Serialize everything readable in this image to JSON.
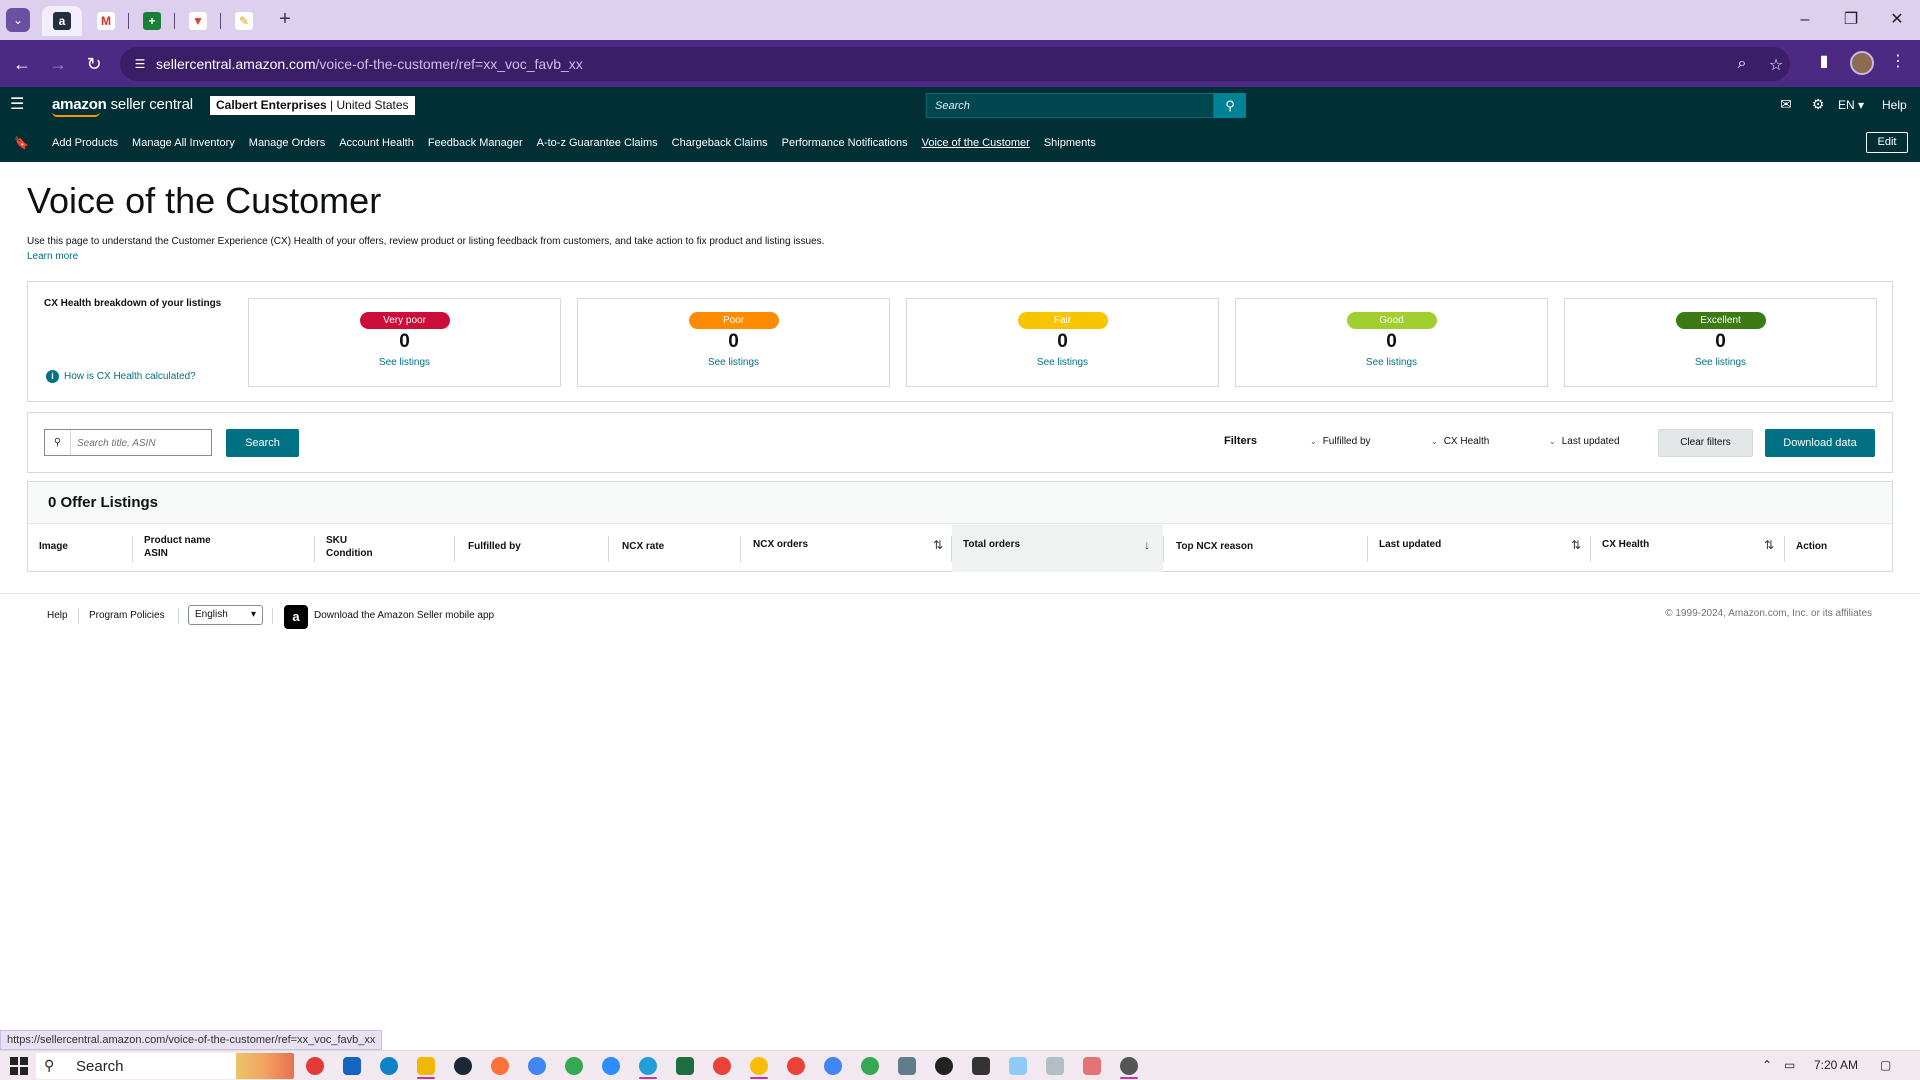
{
  "browser": {
    "tabs": [
      {
        "icon": "amazon-favicon",
        "active": true
      },
      {
        "icon": "gmail-favicon"
      },
      {
        "icon": "sheets-favicon"
      },
      {
        "icon": "todoist-favicon"
      },
      {
        "icon": "pen-favicon"
      }
    ],
    "url_host": "sellercentral.amazon.com",
    "url_path": "/voice-of-the-customer/ref=xx_voc_favb_xx"
  },
  "header": {
    "logo_main": "amazon",
    "logo_sub": "seller central",
    "account_name": "Calbert Enterprises",
    "account_region": "United States",
    "search_placeholder": "Search",
    "language": "EN",
    "help": "Help"
  },
  "nav": {
    "items": [
      "Add Products",
      "Manage All Inventory",
      "Manage Orders",
      "Account Health",
      "Feedback Manager",
      "A-to-z Guarantee Claims",
      "Chargeback Claims",
      "Performance Notifications",
      "Voice of the Customer",
      "Shipments"
    ],
    "edit": "Edit"
  },
  "page": {
    "title": "Voice of the Customer",
    "description": "Use this page to understand the Customer Experience (CX) Health of your offers, review product or listing feedback from customers, and take action to fix product and listing issues.",
    "learn_more": "Learn more"
  },
  "health": {
    "title": "CX Health breakdown of your listings",
    "info_link": "How is CX Health calculated?",
    "cards": [
      {
        "label": "Very poor",
        "count": "0",
        "link": "See listings",
        "color": "#cc0c39"
      },
      {
        "label": "Poor",
        "count": "0",
        "link": "See listings",
        "color": "#ff8c00"
      },
      {
        "label": "Fair",
        "count": "0",
        "link": "See listings",
        "color": "#f7c600"
      },
      {
        "label": "Good",
        "count": "0",
        "link": "See listings",
        "color": "#a1cf2f"
      },
      {
        "label": "Excellent",
        "count": "0",
        "link": "See listings",
        "color": "#3b7a14"
      }
    ]
  },
  "filters": {
    "search_placeholder": "Search title, ASIN",
    "search_button": "Search",
    "label": "Filters",
    "dropdowns": [
      "Fulfilled by",
      "CX Health",
      "Last updated"
    ],
    "clear": "Clear filters",
    "download": "Download data"
  },
  "listings": {
    "title": "0 Offer Listings",
    "columns": {
      "image": "Image",
      "product_name": "Product name",
      "asin": "ASIN",
      "sku": "SKU",
      "condition": "Condition",
      "fulfilled_by": "Fulfilled by",
      "ncx_rate": "NCX rate",
      "ncx_orders": "NCX orders",
      "total_orders": "Total orders",
      "top_ncx_reason": "Top NCX reason",
      "last_updated": "Last updated",
      "cx_health": "CX Health",
      "action": "Action"
    }
  },
  "footer": {
    "help": "Help",
    "policies": "Program Policies",
    "language": "English",
    "app": "Download the Amazon Seller mobile app",
    "copyright": "© 1999-2024, Amazon.com, Inc. or its affiliates"
  },
  "status_url": "https://sellercentral.amazon.com/voice-of-the-customer/ref=xx_voc_favb_xx",
  "taskbar": {
    "search": "Search",
    "time": "7:20 AM"
  }
}
